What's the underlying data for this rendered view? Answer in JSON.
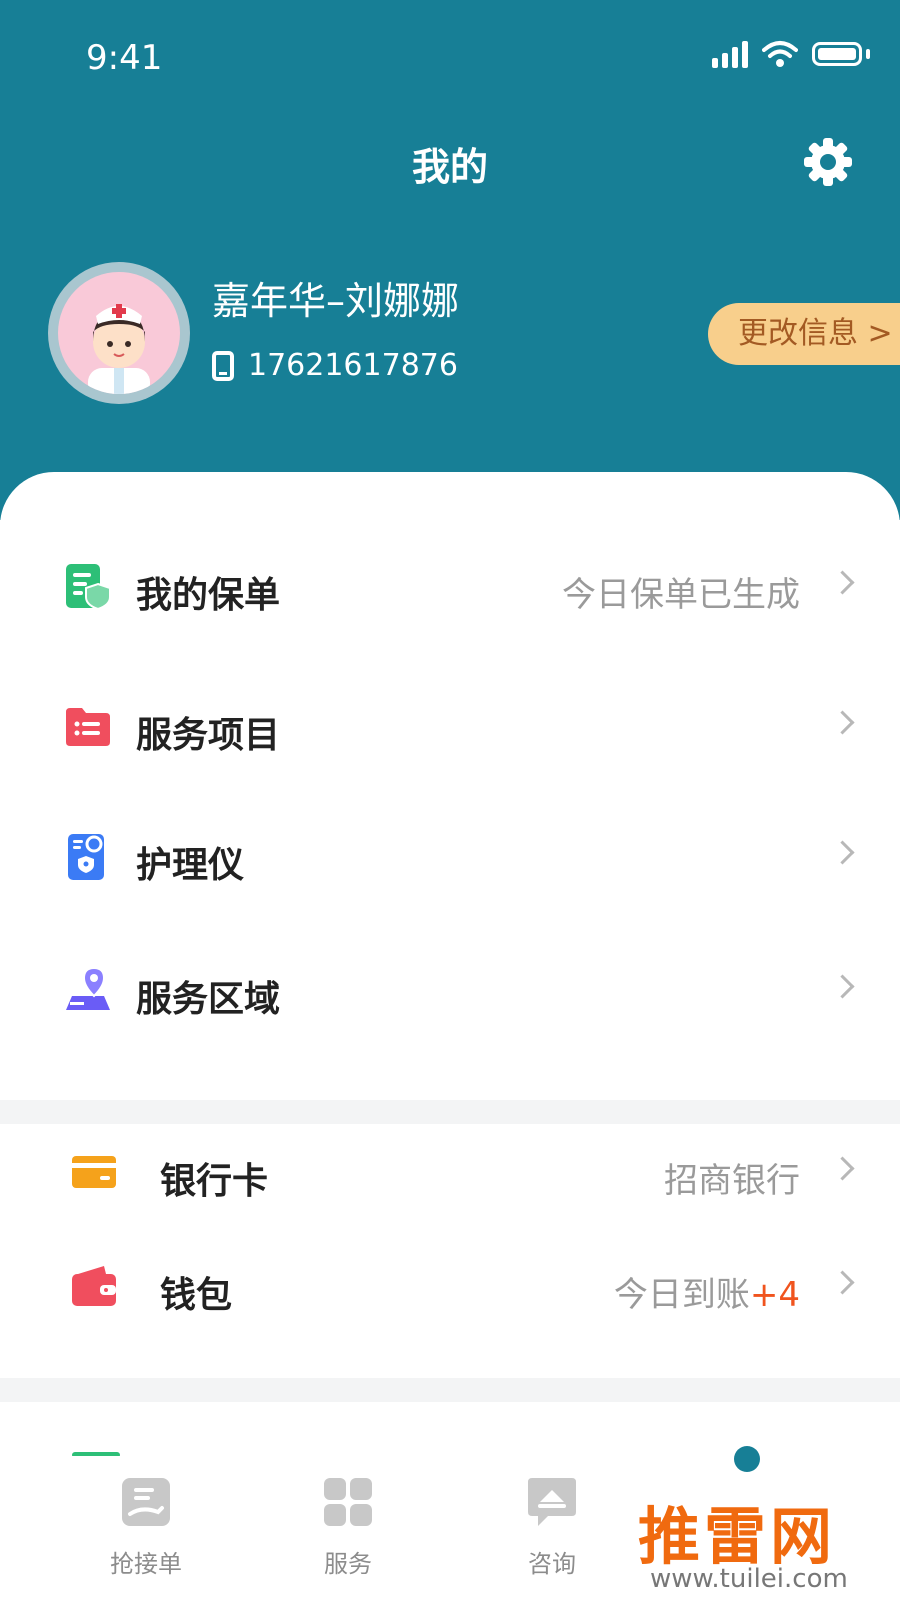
{
  "status_bar": {
    "time": "9:41"
  },
  "header": {
    "title": "我的"
  },
  "profile": {
    "name": "嘉年华–刘娜娜",
    "phone": "17621617876",
    "edit_button": "更改信息 >"
  },
  "menu_group1": [
    {
      "label": "我的保单",
      "value": "今日保单已生成",
      "icon": "policy-icon",
      "color": "#2dbf77"
    },
    {
      "label": "服务项目",
      "value": "",
      "icon": "folder-icon",
      "color": "#f04e5e"
    },
    {
      "label": "护理仪",
      "value": "",
      "icon": "device-icon",
      "color": "#3b7bf5"
    },
    {
      "label": "服务区域",
      "value": "",
      "icon": "location-icon",
      "color": "#6a5cf6"
    }
  ],
  "menu_group2": [
    {
      "label": "银行卡",
      "value": "招商银行",
      "icon": "card-icon",
      "color": "#f5a21b"
    },
    {
      "label": "钱包",
      "value_prefix": "今日到账",
      "value_highlight": "+4",
      "icon": "wallet-icon",
      "color": "#f04e5e",
      "highlight_color": "#f0541e"
    }
  ],
  "tabbar": [
    {
      "label": "抢接单",
      "icon": "grab-order-icon"
    },
    {
      "label": "服务",
      "icon": "grid-icon"
    },
    {
      "label": "咨询",
      "icon": "chat-icon"
    }
  ],
  "watermark": {
    "big": "推雷网",
    "small": "www.tuilei.com"
  },
  "colors": {
    "header_bg": "#177f96",
    "separator": "#f3f4f5"
  }
}
